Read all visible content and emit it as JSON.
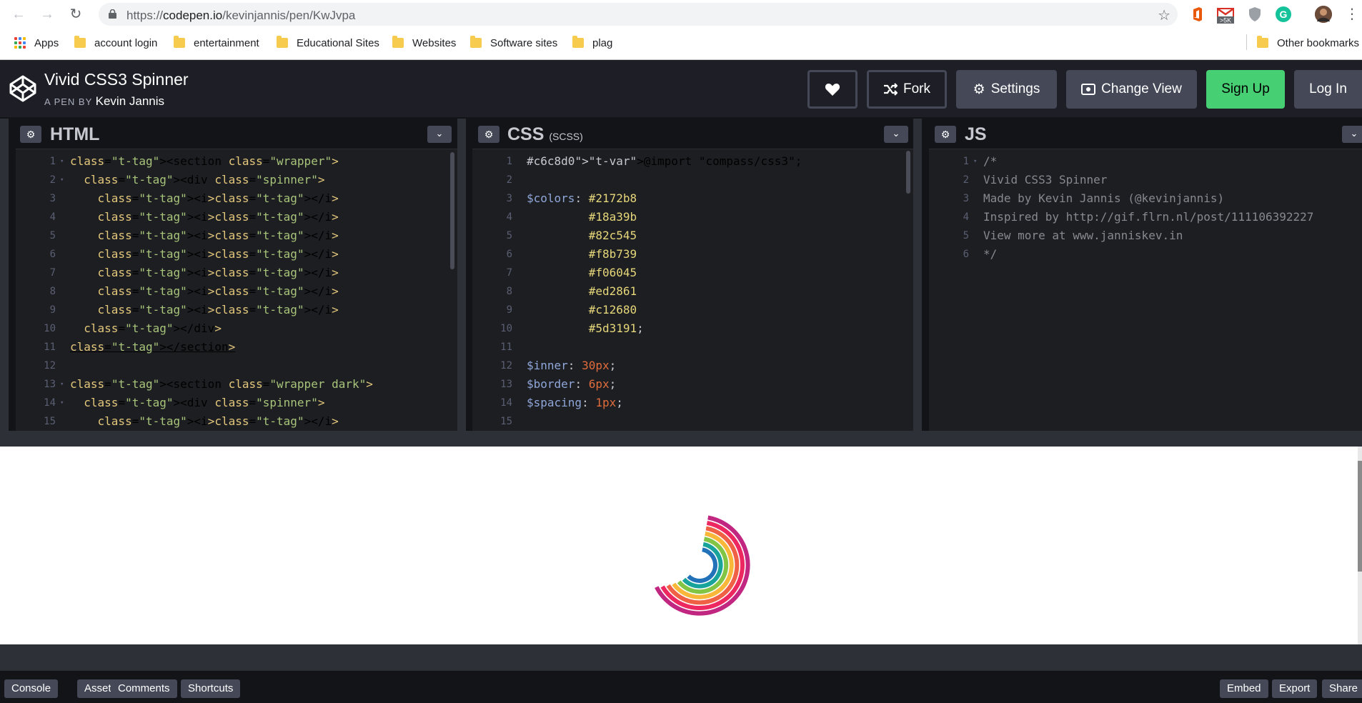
{
  "browser": {
    "url_prefix": "https://",
    "url_host": "codepen.io",
    "url_path": "/kevinjannis/pen/KwJvpa",
    "gmail_badge": ">5K",
    "bookmarks": [
      {
        "label": "Apps",
        "icon": "apps-grid-icon"
      },
      {
        "label": "account login",
        "icon": "folder-icon"
      },
      {
        "label": "entertainment",
        "icon": "folder-icon"
      },
      {
        "label": "Educational Sites",
        "icon": "folder-icon"
      },
      {
        "label": "Websites",
        "icon": "folder-icon"
      },
      {
        "label": "Software sites",
        "icon": "folder-icon"
      },
      {
        "label": "plag",
        "icon": "folder-icon"
      }
    ],
    "other_bookmarks": "Other bookmarks"
  },
  "header": {
    "title": "Vivid CSS3 Spinner",
    "by_label": "A PEN BY",
    "author": "Kevin Jannis",
    "fork_label": "Fork",
    "settings_label": "Settings",
    "change_view_label": "Change View",
    "signup_label": "Sign Up",
    "login_label": "Log In"
  },
  "editors": {
    "html": {
      "title": "HTML",
      "subtitle": ""
    },
    "css": {
      "title": "CSS",
      "subtitle": "(SCSS)"
    },
    "js": {
      "title": "JS",
      "subtitle": ""
    }
  },
  "html_code": [
    {
      "n": "1",
      "fold": true,
      "text": "<section class=\"wrapper\">"
    },
    {
      "n": "2",
      "fold": true,
      "text": "  <div class=\"spinner\">"
    },
    {
      "n": "3",
      "fold": false,
      "text": "    <i></i>"
    },
    {
      "n": "4",
      "fold": false,
      "text": "    <i></i>"
    },
    {
      "n": "5",
      "fold": false,
      "text": "    <i></i>"
    },
    {
      "n": "6",
      "fold": false,
      "text": "    <i></i>"
    },
    {
      "n": "7",
      "fold": false,
      "text": "    <i></i>"
    },
    {
      "n": "8",
      "fold": false,
      "text": "    <i></i>"
    },
    {
      "n": "9",
      "fold": false,
      "text": "    <i></i>"
    },
    {
      "n": "10",
      "fold": false,
      "text": "  </div>"
    },
    {
      "n": "11",
      "fold": false,
      "text": "</section>"
    },
    {
      "n": "12",
      "fold": false,
      "text": ""
    },
    {
      "n": "13",
      "fold": true,
      "text": "<section class=\"wrapper dark\">"
    },
    {
      "n": "14",
      "fold": true,
      "text": "  <div class=\"spinner\">"
    },
    {
      "n": "15",
      "fold": false,
      "text": "    <i></i>"
    }
  ],
  "css_code": [
    {
      "n": "1",
      "text": "@import \"compass/css3\";"
    },
    {
      "n": "2",
      "text": ""
    },
    {
      "n": "3",
      "text": "$colors: #2172b8"
    },
    {
      "n": "4",
      "text": "         #18a39b"
    },
    {
      "n": "5",
      "text": "         #82c545"
    },
    {
      "n": "6",
      "text": "         #f8b739"
    },
    {
      "n": "7",
      "text": "         #f06045"
    },
    {
      "n": "8",
      "text": "         #ed2861"
    },
    {
      "n": "9",
      "text": "         #c12680"
    },
    {
      "n": "10",
      "text": "         #5d3191;"
    },
    {
      "n": "11",
      "text": ""
    },
    {
      "n": "12",
      "text": "$inner: 30px;"
    },
    {
      "n": "13",
      "text": "$border: 6px;"
    },
    {
      "n": "14",
      "text": "$spacing: 1px;"
    },
    {
      "n": "15",
      "text": ""
    }
  ],
  "js_code": [
    {
      "n": "1",
      "fold": true,
      "text": "/*"
    },
    {
      "n": "2",
      "fold": false,
      "text": "Vivid CSS3 Spinner"
    },
    {
      "n": "3",
      "fold": false,
      "text": "Made by Kevin Jannis (@kevinjannis)"
    },
    {
      "n": "4",
      "fold": false,
      "text": "Inspired by http://gif.flrn.nl/post/111106392227"
    },
    {
      "n": "5",
      "fold": false,
      "text": "View more at www.janniskev.in"
    },
    {
      "n": "6",
      "fold": false,
      "text": "*/"
    }
  ],
  "spinner_colors": [
    "#2172b8",
    "#18a39b",
    "#82c545",
    "#f8b739",
    "#f06045",
    "#ed2861",
    "#c12680"
  ],
  "footer": {
    "left": [
      "Console",
      "Assets",
      "Comments",
      "Shortcuts"
    ],
    "right": [
      "Embed",
      "Export",
      "Share"
    ]
  }
}
